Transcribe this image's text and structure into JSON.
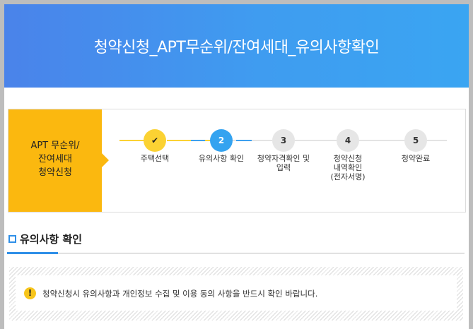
{
  "header": {
    "title": "청약신청_APT무순위/잔여세대_유의사항확인"
  },
  "step_panel": {
    "label": "APT 무순위/\n잔여세대\n청약신청",
    "steps": [
      {
        "number": "✔",
        "caption": "주택선택",
        "state": "done"
      },
      {
        "number": "2",
        "caption": "유의사항 확인",
        "state": "current"
      },
      {
        "number": "3",
        "caption": "청약자격확인 및\n입력",
        "state": "pending"
      },
      {
        "number": "4",
        "caption": "청약신청\n내역확인\n(전자서명)",
        "state": "pending"
      },
      {
        "number": "5",
        "caption": "청약완료",
        "state": "pending"
      }
    ],
    "colors": {
      "done": "#fbd233",
      "current": "#34a3f0",
      "pending": "#e6e6e6"
    }
  },
  "section": {
    "title": "유의사항 확인"
  },
  "notice": {
    "icon_text": "!",
    "icon_name": "exclamation-icon",
    "text": "청약신청시 유의사항과 개인정보 수집 및 이용 동의 사항을 반드시 확인 바랍니다."
  }
}
